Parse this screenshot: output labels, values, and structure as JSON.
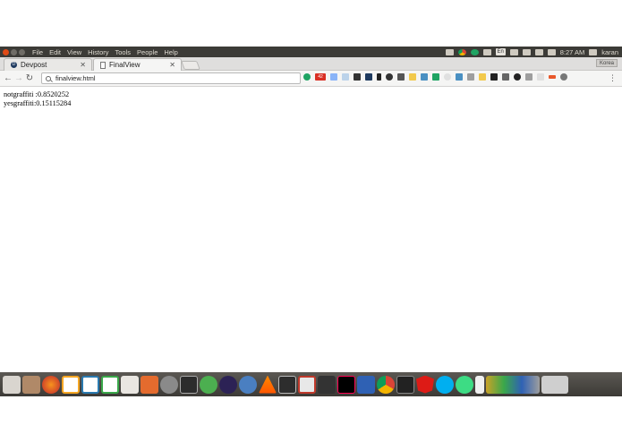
{
  "panel": {
    "menus": [
      "File",
      "Edit",
      "View",
      "History",
      "Tools",
      "People",
      "Help"
    ],
    "tray_lang": "En",
    "clock": "8:27 AM",
    "user": "karan"
  },
  "tabs": [
    {
      "title": "Devpost",
      "active": false
    },
    {
      "title": "FinalView",
      "active": true
    }
  ],
  "profile_label": "Korea",
  "toolbar": {
    "address_value": "finalview.html",
    "badge_count": "42"
  },
  "page": {
    "lines": [
      "notgraffiti :0.8520252",
      "yesgraffiti:0.15115284"
    ]
  },
  "dock_icons": [
    "dash-icon",
    "files-icon",
    "firefox-icon",
    "libreoffice-writer-icon",
    "libreoffice-impress-icon",
    "libreoffice-calc-icon",
    "text-editor-icon",
    "software-center-icon",
    "settings-icon",
    "remote-desktop-icon",
    "unity-icon",
    "eclipse-icon",
    "cloud-icon",
    "vlc-icon",
    "terminal-icon",
    "libreoffice-icon",
    "inkscape-icon",
    "intellij-icon",
    "virtualbox-icon",
    "chrome-icon",
    "system-monitor-icon",
    "angular-icon",
    "skype-icon",
    "android-studio-icon",
    "document-viewer-icon",
    "media-icon",
    "trash-icon"
  ],
  "colors": {
    "panel_bg": "#3c3b37",
    "close_btn": "#df4a16",
    "dock_bg": "#3c3a36"
  }
}
